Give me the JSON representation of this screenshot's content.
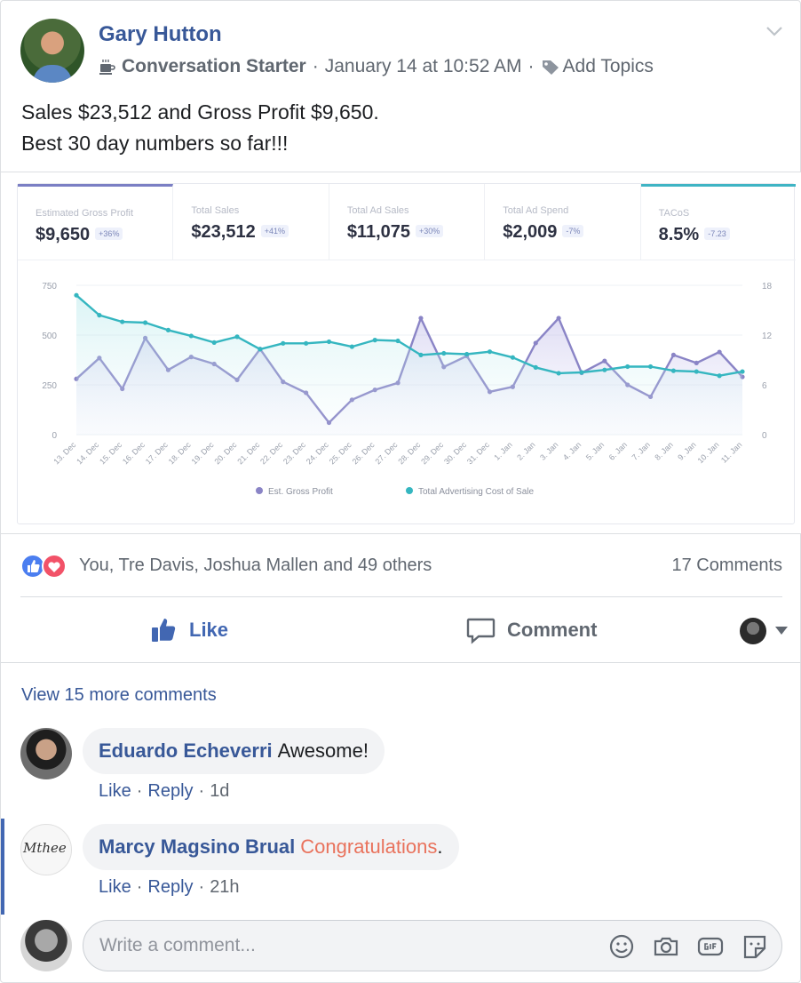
{
  "post": {
    "author": "Gary Hutton",
    "badge": "Conversation Starter",
    "timestamp": "January 14 at 10:52 AM",
    "add_topics": "Add Topics",
    "text_line1": "Sales $23,512 and Gross Profit $9,650.",
    "text_line2": "Best 30 day numbers so far!!!"
  },
  "stats": [
    {
      "label": "Estimated Gross Profit",
      "value": "$9,650",
      "change": "+36%"
    },
    {
      "label": "Total Sales",
      "value": "$23,512",
      "change": "+41%"
    },
    {
      "label": "Total Ad Sales",
      "value": "$11,075",
      "change": "+30%"
    },
    {
      "label": "Total Ad Spend",
      "value": "$2,009",
      "change": "-7%"
    },
    {
      "label": "TACoS",
      "value": "8.5%",
      "change": "-7.23"
    }
  ],
  "chart_data": {
    "type": "line",
    "x": [
      "13. Dec",
      "14. Dec",
      "15. Dec",
      "16. Dec",
      "17. Dec",
      "18. Dec",
      "19. Dec",
      "20. Dec",
      "21. Dec",
      "22. Dec",
      "23. Dec",
      "24. Dec",
      "25. Dec",
      "26. Dec",
      "27. Dec",
      "28. Dec",
      "29. Dec",
      "30. Dec",
      "31. Dec",
      "1. Jan",
      "2. Jan",
      "3. Jan",
      "4. Jan",
      "5. Jan",
      "6. Jan",
      "7. Jan",
      "8. Jan",
      "9. Jan",
      "10. Jan",
      "11. Jan"
    ],
    "series": [
      {
        "name": "Est. Gross Profit",
        "axis": "left",
        "color": "#8a84c6",
        "values": [
          280,
          385,
          230,
          485,
          325,
          390,
          355,
          275,
          430,
          265,
          210,
          60,
          175,
          225,
          260,
          585,
          340,
          395,
          215,
          240,
          460,
          585,
          310,
          370,
          250,
          190,
          400,
          360,
          415,
          290
        ]
      },
      {
        "name": "Total Advertising Cost of Sale",
        "axis": "right",
        "color": "#35b6c0",
        "values": [
          16.8,
          14.4,
          13.6,
          13.5,
          12.6,
          11.9,
          11.1,
          11.8,
          10.3,
          11.0,
          11.0,
          11.2,
          10.6,
          11.4,
          11.3,
          9.6,
          9.8,
          9.7,
          10.0,
          9.3,
          8.1,
          7.4,
          7.5,
          7.8,
          8.2,
          8.2,
          7.7,
          7.6,
          7.1,
          7.6
        ]
      }
    ],
    "y_left_ticks": [
      0,
      250,
      500,
      750
    ],
    "y_right_ticks": [
      0,
      6,
      12,
      18
    ],
    "ylim_left": [
      0,
      750
    ],
    "ylim_right": [
      0,
      18
    ],
    "grid": true,
    "legend": "bottom"
  },
  "engagement": {
    "reactions_text": "You, Tre Davis, Joshua Mallen and 49 others",
    "comments_count": "17 Comments",
    "like_label": "Like",
    "comment_label": "Comment",
    "view_more": "View 15 more comments"
  },
  "comments": [
    {
      "name": "Eduardo Echeverri",
      "text": "Awesome!",
      "like": "Like",
      "reply": "Reply",
      "age": "1d"
    },
    {
      "name": "Marcy Magsino Brual",
      "text": "Congratulations",
      "suffix": ".",
      "like": "Like",
      "reply": "Reply",
      "age": "21h",
      "avatar_text": "Mthee"
    }
  ],
  "composer": {
    "placeholder": "Write a comment..."
  },
  "colors": {
    "link": "#385898",
    "accent_purple": "#8a84c6",
    "accent_teal": "#35b6c0",
    "like_blue": "#4267b2",
    "love_red": "#f25268"
  }
}
